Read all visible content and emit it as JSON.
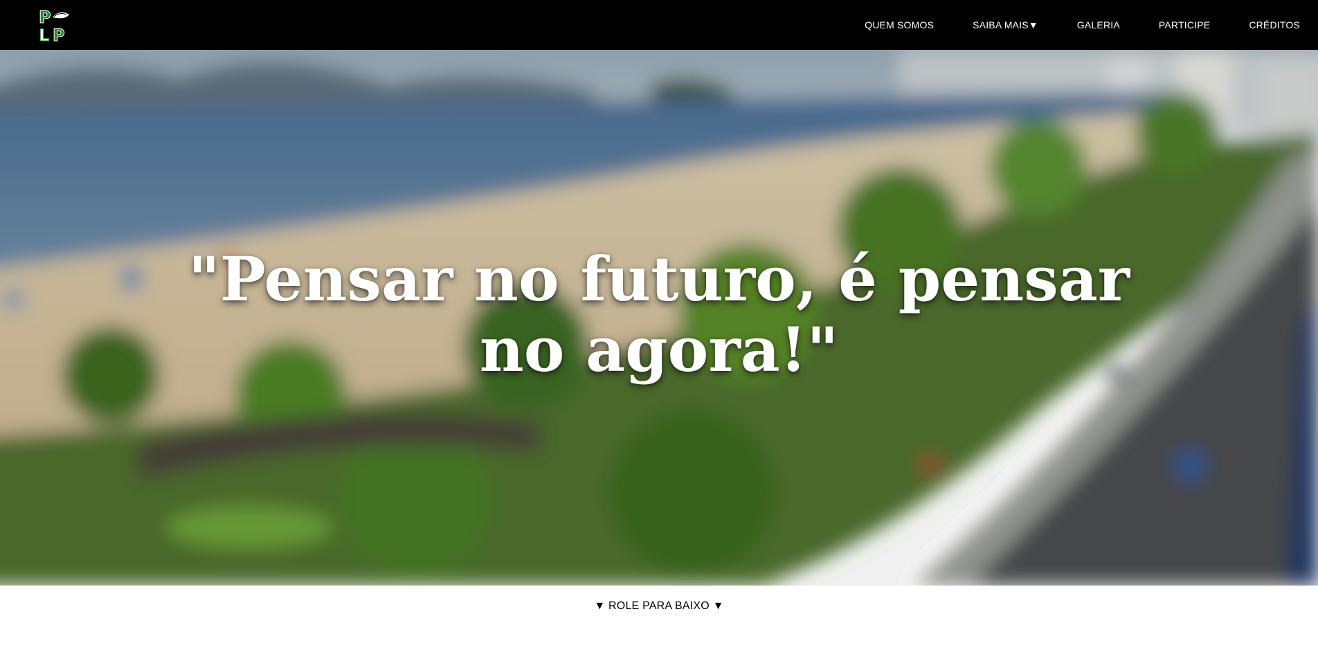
{
  "nav": {
    "logo_alt": "PLP",
    "items": [
      {
        "label": "QUEM SOMOS"
      },
      {
        "label": "SAIBA MAIS▼"
      },
      {
        "label": "GALERIA"
      },
      {
        "label": "PARTICIPE"
      },
      {
        "label": "CRÉDITOS"
      }
    ]
  },
  "hero": {
    "quote": "\"Pensar no futuro, é pensar no agora!\""
  },
  "scroll_hint": {
    "label": "▼ ROLE PARA BAIXO ▼"
  },
  "colors": {
    "navbar": "#000000",
    "logo_green": "#1e8a2e",
    "text_light": "#ffffff",
    "text_dark": "#000000"
  }
}
